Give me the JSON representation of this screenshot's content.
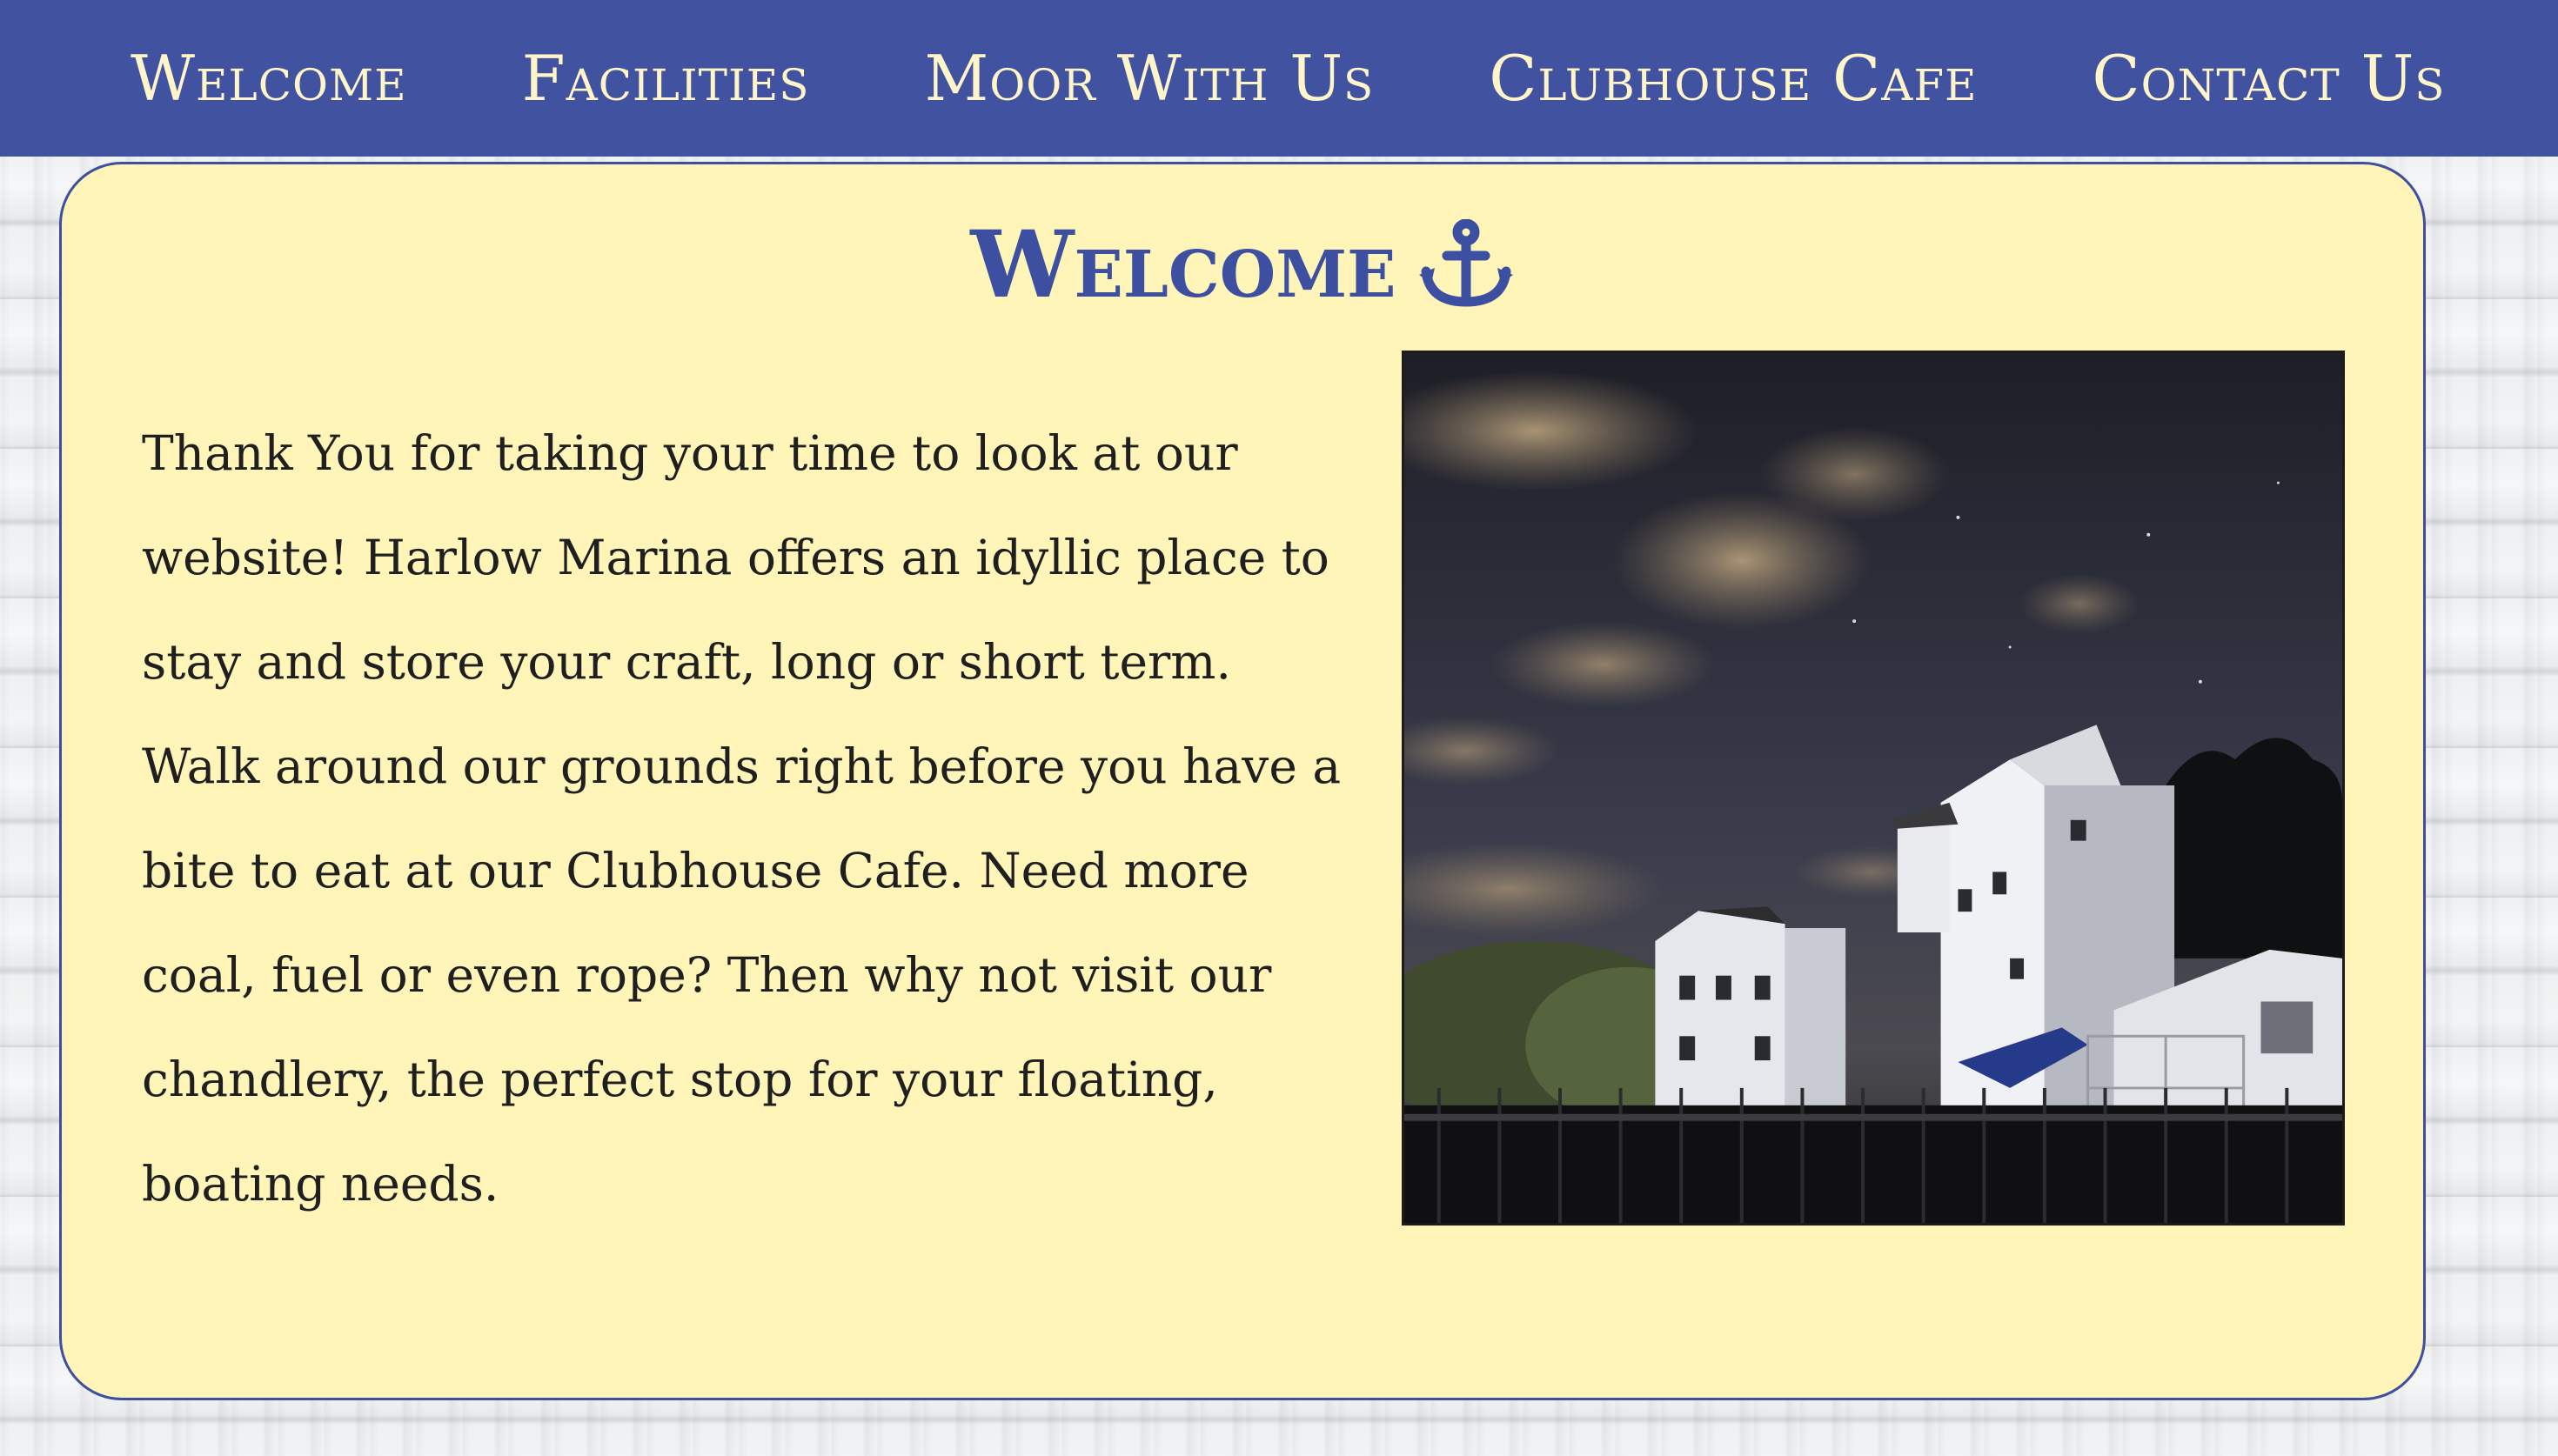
{
  "nav": {
    "items": [
      {
        "label": "Welcome"
      },
      {
        "label": "Facilities"
      },
      {
        "label": "Moor With Us"
      },
      {
        "label": "Clubhouse Cafe"
      },
      {
        "label": "Contact Us"
      }
    ]
  },
  "main": {
    "title": "Welcome",
    "title_icon": "anchor-icon",
    "intro_text": "Thank You for taking your time to look at our website! Harlow Marina offers an idyllic place to stay and store your craft, long or short term. Walk around our grounds right before you have a bite to eat at our Clubhouse Cafe. Need more coal, fuel or even rope? Then why not visit our chandlery, the perfect stop for your floating, boating needs.",
    "photo_subject": "marina buildings at night"
  },
  "colors": {
    "nav_bg": "#4152a1",
    "nav_text": "#fff5c8",
    "panel_bg": "#fff5b8",
    "accent": "#3d4fa0",
    "body_text": "#1f1f1f"
  }
}
